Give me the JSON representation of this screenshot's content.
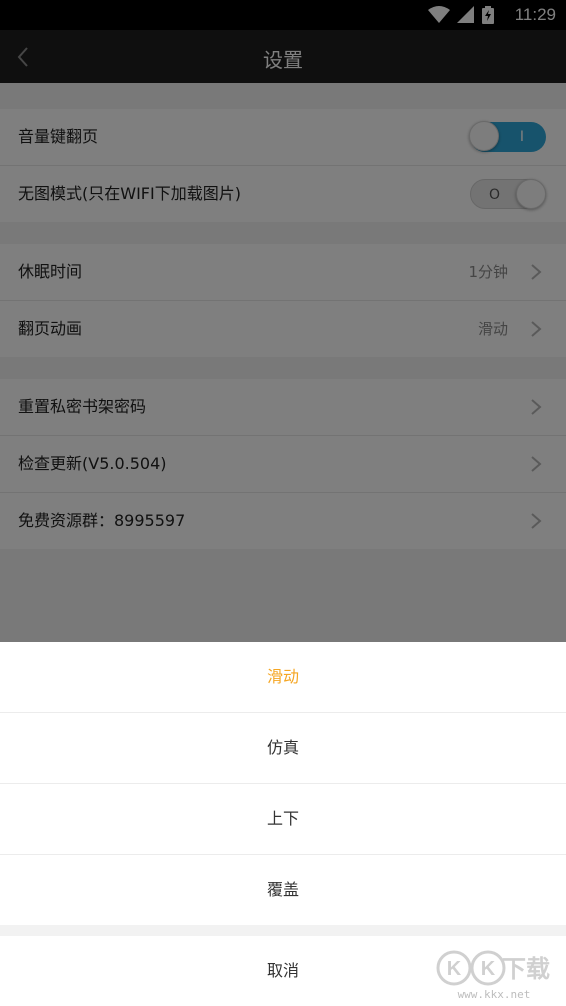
{
  "status_bar": {
    "time": "11:29",
    "icons": [
      "wifi-icon",
      "signal-icon",
      "battery-charging-icon"
    ]
  },
  "app_bar": {
    "back_icon": "chevron-left-icon",
    "title": "设置"
  },
  "settings": {
    "group1": [
      {
        "label": "音量键翻页",
        "toggle": "on",
        "mark": "I"
      },
      {
        "label": "无图模式(只在WIFI下加载图片)",
        "toggle": "off",
        "mark": "O"
      }
    ],
    "group2": [
      {
        "label": "休眠时间",
        "value": "1分钟"
      },
      {
        "label": "翻页动画",
        "value": "滑动"
      }
    ],
    "group3": [
      {
        "label": "重置私密书架密码"
      },
      {
        "label": "检查更新(V5.0.504)"
      },
      {
        "label": "免费资源群：8995597"
      }
    ]
  },
  "action_sheet": {
    "options": [
      {
        "label": "滑动",
        "selected": true
      },
      {
        "label": "仿真",
        "selected": false
      },
      {
        "label": "上下",
        "selected": false
      },
      {
        "label": "覆盖",
        "selected": false
      }
    ],
    "cancel": "取消",
    "selected_color": "#f5a623"
  },
  "watermark": {
    "logo": "KK下载",
    "url": "www.kkx.net"
  },
  "colors": {
    "toggle_on": "#2fa7d8",
    "app_bar": "#1f1f1f"
  }
}
